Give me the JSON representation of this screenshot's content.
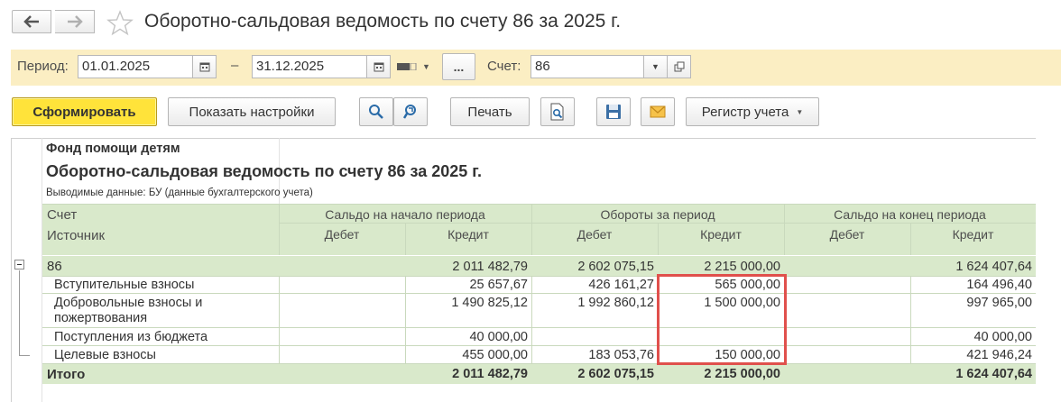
{
  "window": {
    "title": "Оборотно-сальдовая ведомость по счету 86 за 2025 г."
  },
  "filter": {
    "period_label": "Период:",
    "date_from": "01.01.2025",
    "dash": "–",
    "date_to": "31.12.2025",
    "more_label": "...",
    "account_label": "Счет:",
    "account_value": "86"
  },
  "toolbar": {
    "generate_label": "Сформировать",
    "settings_label": "Показать настройки",
    "print_label": "Печать",
    "register_label": "Регистр учета"
  },
  "report": {
    "org": "Фонд помощи детям",
    "title": "Оборотно-сальдовая ведомость по счету 86 за 2025 г.",
    "output_note": "Выводимые данные: БУ (данные бухгалтерского учета)",
    "header": {
      "col1_line1": "Счет",
      "col1_line2": "Источник",
      "opening": "Сальдо на начало периода",
      "turnover": "Обороты за период",
      "closing": "Сальдо на конец периода",
      "debit": "Дебет",
      "credit": "Кредит"
    },
    "account_row": {
      "name": "86",
      "open_debit": "",
      "open_credit": "2 011 482,79",
      "turn_debit": "2 602 075,15",
      "turn_credit": "2 215 000,00",
      "close_debit": "",
      "close_credit": "1 624 407,64"
    },
    "rows": [
      {
        "name": "Вступительные взносы",
        "name2": "",
        "open_debit": "",
        "open_credit": "25 657,67",
        "turn_debit": "426 161,27",
        "turn_credit": "565 000,00",
        "close_debit": "",
        "close_credit": "164 496,40"
      },
      {
        "name": "Добровольные взносы и",
        "name2": "пожертвования",
        "open_debit": "",
        "open_credit": "1 490 825,12",
        "turn_debit": "1 992 860,12",
        "turn_credit": "1 500 000,00",
        "close_debit": "",
        "close_credit": "997 965,00"
      },
      {
        "name": "Поступления из бюджета",
        "name2": "",
        "open_debit": "",
        "open_credit": "40 000,00",
        "turn_debit": "",
        "turn_credit": "",
        "close_debit": "",
        "close_credit": "40 000,00"
      },
      {
        "name": "Целевые взносы",
        "name2": "",
        "open_debit": "",
        "open_credit": "455 000,00",
        "turn_debit": "183 053,76",
        "turn_credit": "150 000,00",
        "close_debit": "",
        "close_credit": "421 946,24"
      }
    ],
    "total_row": {
      "name": "Итого",
      "open_debit": "",
      "open_credit": "2 011 482,79",
      "turn_debit": "2 602 075,15",
      "turn_credit": "2 215 000,00",
      "close_debit": "",
      "close_credit": "1 624 407,64"
    }
  },
  "colors": {
    "accent_yellow": "#ffe33a",
    "filter_bg": "#fbeec3",
    "header_bg": "#d9e9cb",
    "highlight": "#e0504c"
  }
}
